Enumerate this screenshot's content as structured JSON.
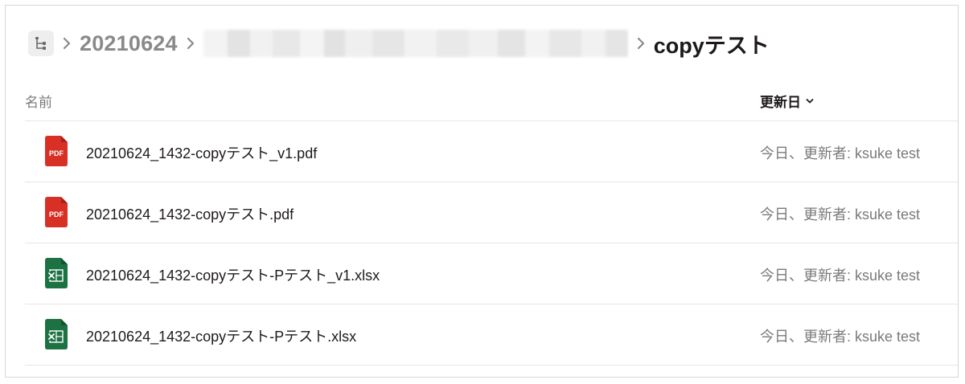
{
  "breadcrumb": {
    "folder": "20210624",
    "current": "copyテスト"
  },
  "table": {
    "columns": {
      "name": "名前",
      "modified": "更新日"
    },
    "rows": [
      {
        "name": "20210624_1432-copyテスト_v1.pdf",
        "type": "pdf",
        "icon_label": "PDF",
        "modified": "今日、更新者: ksuke test"
      },
      {
        "name": "20210624_1432-copyテスト.pdf",
        "type": "pdf",
        "icon_label": "PDF",
        "modified": "今日、更新者: ksuke test"
      },
      {
        "name": "20210624_1432-copyテスト-Pテスト_v1.xlsx",
        "type": "xlsx",
        "icon_label": "",
        "modified": "今日、更新者: ksuke test"
      },
      {
        "name": "20210624_1432-copyテスト-Pテスト.xlsx",
        "type": "xlsx",
        "icon_label": "",
        "modified": "今日、更新者: ksuke test"
      }
    ]
  },
  "colors": {
    "pdf": "#d93025",
    "xlsx": "#1d7244",
    "text": "#1e1919",
    "muted": "#7a7a7a"
  },
  "icons": {
    "tree": "folder-tree-icon",
    "chevron": "chevron-right-icon",
    "sort": "chevron-down-icon"
  }
}
